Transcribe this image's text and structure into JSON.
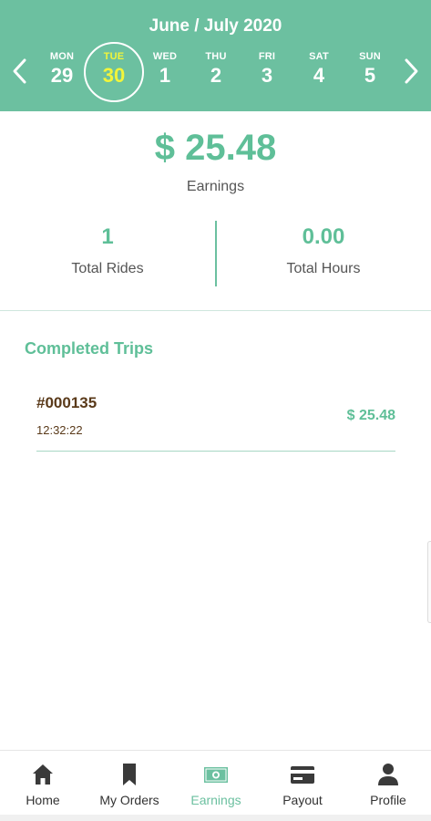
{
  "header": {
    "title": "June / July 2020",
    "days": [
      {
        "name": "MON",
        "num": "29"
      },
      {
        "name": "TUE",
        "num": "30"
      },
      {
        "name": "WED",
        "num": "1"
      },
      {
        "name": "THU",
        "num": "2"
      },
      {
        "name": "FRI",
        "num": "3"
      },
      {
        "name": "SAT",
        "num": "4"
      },
      {
        "name": "SUN",
        "num": "5"
      }
    ],
    "selected_day": "TUE 30"
  },
  "summary": {
    "amount": "$ 25.48",
    "amount_label": "Earnings",
    "total_rides": "1",
    "total_rides_label": "Total Rides",
    "total_hours": "0.00",
    "total_hours_label": "Total Hours"
  },
  "completed": {
    "title": "Completed Trips",
    "trips": [
      {
        "id": "#000135",
        "time": "12:32:22",
        "amount": "$ 25.48"
      }
    ]
  },
  "bottom_nav": {
    "items": [
      {
        "label": "Home",
        "icon": "home-icon"
      },
      {
        "label": "My Orders",
        "icon": "bookmark-icon"
      },
      {
        "label": "Earnings",
        "icon": "money-icon"
      },
      {
        "label": "Payout",
        "icon": "credit-card-icon"
      },
      {
        "label": "Profile",
        "icon": "person-icon"
      }
    ],
    "active": "Earnings"
  },
  "colors": {
    "primary": "#6cc0a0",
    "accent_text": "#5fbf98",
    "selected_day": "#f2f53a",
    "trip_text": "#5a3a1a"
  }
}
